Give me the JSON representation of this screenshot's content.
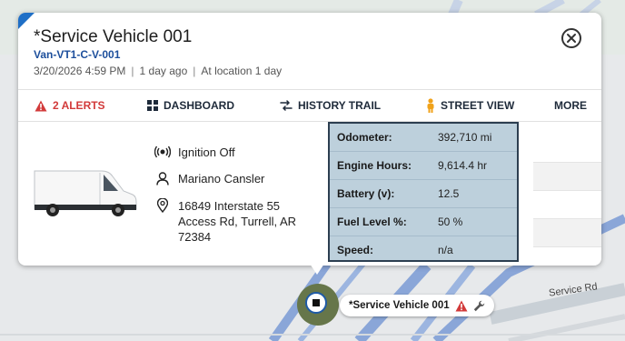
{
  "vehicle": {
    "name": "*Service Vehicle 001",
    "id": "Van-VT1-C-V-001",
    "datetime": "3/20/2026 4:59 PM",
    "age": "1 day ago",
    "location_status": "At location 1 day"
  },
  "tabs": {
    "alerts": "2 ALERTS",
    "dashboard": "DASHBOARD",
    "history": "HISTORY TRAIL",
    "street": "STREET VIEW",
    "more": "MORE"
  },
  "info": {
    "ignition": "Ignition Off",
    "driver": "Mariano Cansler",
    "address_line1": "16849 Interstate 55",
    "address_line2": "Access Rd, Turrell, AR",
    "address_line3": "72384"
  },
  "stats": [
    {
      "label": "Odometer:",
      "value": "392,710 mi"
    },
    {
      "label": "Engine Hours:",
      "value": "9,614.4 hr"
    },
    {
      "label": "Battery (v):",
      "value": "12.5"
    },
    {
      "label": "Fuel Level %:",
      "value": "50 %"
    },
    {
      "label": "Speed:",
      "value": "n/a"
    }
  ],
  "map": {
    "marker_label": "*Service Vehicle 001",
    "road_label": "Service Rd"
  },
  "icons": [
    "warning-icon",
    "dashboard-grid-icon",
    "history-trail-icon",
    "street-view-pegman-icon",
    "close-icon",
    "ignition-icon",
    "person-icon",
    "location-pin-icon",
    "wrench-icon",
    "vehicle-stop-icon"
  ],
  "colors": {
    "alert": "#d23a3a",
    "link": "#1d4f9c",
    "stats_bg": "#bdd0dc",
    "marker_ring": "#66764a"
  }
}
